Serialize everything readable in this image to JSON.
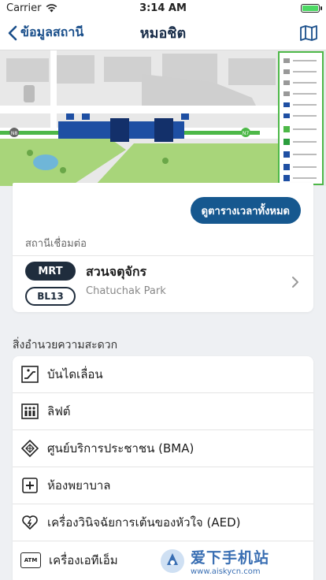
{
  "status_bar": {
    "carrier": "Carrier",
    "time": "3:14 AM"
  },
  "nav": {
    "back_label": "ข้อมูลสถานี",
    "title": "หมอชิต"
  },
  "map": {
    "station_codes": [
      "N8",
      "N7",
      "N9"
    ],
    "colors": {
      "green_line": "#4db848",
      "blue_line": "#1e4fa3",
      "park": "#a8d57a",
      "road": "#ffffff"
    }
  },
  "schedule_button": "ดูตารางเวลาทั้งหมด",
  "connection": {
    "label": "สถานีเชื่อมต่อ",
    "line": "MRT",
    "code": "BL13",
    "name_th": "สวนจตุจักร",
    "name_en": "Chatuchak Park"
  },
  "facilities": {
    "title": "สิ่งอำนวยความสะดวก",
    "items": [
      {
        "label": "บันไดเลื่อน",
        "icon": "escalator-icon"
      },
      {
        "label": "ลิฟต์",
        "icon": "elevator-icon"
      },
      {
        "label": "ศูนย์บริการประชาชน (BMA)",
        "icon": "service-center-icon"
      },
      {
        "label": "ห้องพยาบาล",
        "icon": "first-aid-icon"
      },
      {
        "label": "เครื่องวินิจฉัยการเต้นของหัวใจ (AED)",
        "icon": "aed-icon"
      },
      {
        "label": "เครื่องเอทีเอ็ม",
        "icon": "atm-icon",
        "icon_text": "ATM"
      }
    ]
  },
  "watermark": {
    "cn": "爱下手机站",
    "url": "www.aiskycn.com"
  }
}
